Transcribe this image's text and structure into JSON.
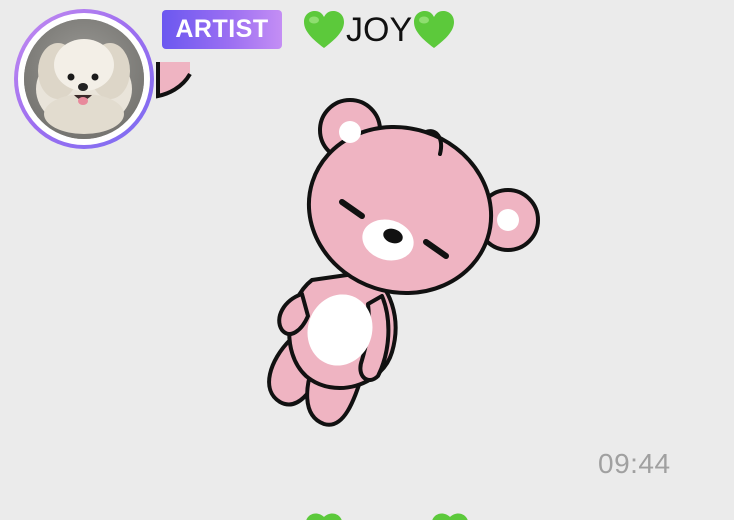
{
  "message": {
    "sender_badge": "ARTIST",
    "sender_name": "JOY",
    "name_icon": "green-heart-icon",
    "sticker": "pink-bear-sticker",
    "time": "09:44"
  },
  "colors": {
    "background": "#ebebeb",
    "badge_gradient_start": "#6b58f0",
    "badge_gradient_end": "#c48ef4",
    "heart": "#5cc93b",
    "bear_pink": "#efb4c2",
    "time_text": "#a0a0a0"
  }
}
